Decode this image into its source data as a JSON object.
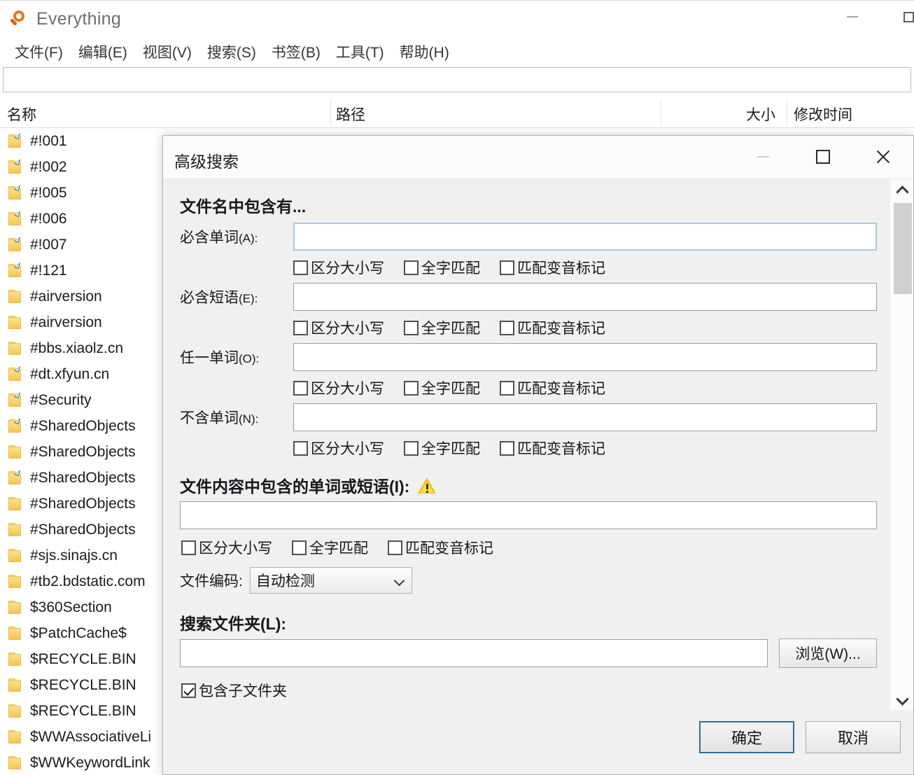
{
  "app": {
    "title": "Everything",
    "logo_icon": "magnifier-icon",
    "window_controls": {
      "minimize": "minimize-icon",
      "maximize": "maximize-icon"
    }
  },
  "menubar": {
    "items": [
      {
        "label": "文件(F)"
      },
      {
        "label": "编辑(E)"
      },
      {
        "label": "视图(V)"
      },
      {
        "label": "搜索(S)"
      },
      {
        "label": "书签(B)"
      },
      {
        "label": "工具(T)"
      },
      {
        "label": "帮助(H)"
      }
    ]
  },
  "search": {
    "value": "",
    "placeholder": ""
  },
  "columns": {
    "name": "名称",
    "path": "路径",
    "size": "大小",
    "date_modified": "修改时间"
  },
  "file_list": {
    "rows": [
      {
        "name": "#!001",
        "icon": "folder-shortcut-icon",
        "shortcut": true
      },
      {
        "name": "#!002",
        "icon": "folder-shortcut-icon",
        "shortcut": true
      },
      {
        "name": "#!005",
        "icon": "folder-shortcut-icon",
        "shortcut": true
      },
      {
        "name": "#!006",
        "icon": "folder-shortcut-icon",
        "shortcut": true
      },
      {
        "name": "#!007",
        "icon": "folder-shortcut-icon",
        "shortcut": true
      },
      {
        "name": "#!121",
        "icon": "folder-shortcut-icon",
        "shortcut": true
      },
      {
        "name": "#airversion",
        "icon": "folder-icon",
        "shortcut": false
      },
      {
        "name": "#airversion",
        "icon": "folder-icon",
        "shortcut": false
      },
      {
        "name": "#bbs.xiaolz.cn",
        "icon": "folder-icon",
        "shortcut": false
      },
      {
        "name": "#dt.xfyun.cn",
        "icon": "folder-shortcut-icon",
        "shortcut": true
      },
      {
        "name": "#Security",
        "icon": "folder-shortcut-icon",
        "shortcut": true
      },
      {
        "name": "#SharedObjects",
        "icon": "folder-shortcut-icon",
        "shortcut": true
      },
      {
        "name": "#SharedObjects",
        "icon": "folder-icon",
        "shortcut": false
      },
      {
        "name": "#SharedObjects",
        "icon": "folder-shortcut-icon",
        "shortcut": true
      },
      {
        "name": "#SharedObjects",
        "icon": "folder-icon",
        "shortcut": false
      },
      {
        "name": "#SharedObjects",
        "icon": "folder-icon",
        "shortcut": false
      },
      {
        "name": "#sjs.sinajs.cn",
        "icon": "folder-icon",
        "shortcut": false
      },
      {
        "name": "#tb2.bdstatic.com",
        "icon": "folder-icon",
        "shortcut": false
      },
      {
        "name": "$360Section",
        "icon": "folder-icon",
        "shortcut": false
      },
      {
        "name": "$PatchCache$",
        "icon": "folder-icon",
        "shortcut": false
      },
      {
        "name": "$RECYCLE.BIN",
        "icon": "folder-icon",
        "shortcut": false
      },
      {
        "name": "$RECYCLE.BIN",
        "icon": "folder-icon",
        "shortcut": false
      },
      {
        "name": "$RECYCLE.BIN",
        "icon": "folder-icon",
        "shortcut": false
      },
      {
        "name": "$WWAssociativeLi",
        "icon": "folder-icon",
        "shortcut": false
      },
      {
        "name": "$WWKeywordLink",
        "icon": "folder-icon",
        "shortcut": false
      }
    ]
  },
  "dialog": {
    "title": "高级搜索",
    "controls": {
      "minimize": "minimize-icon",
      "maximize": "maximize-icon",
      "close": "close-icon"
    },
    "filename_section": {
      "title": "文件名中包含有...",
      "fields": [
        {
          "label": "必含单词",
          "accel": "(A):",
          "value": "",
          "focused": true
        },
        {
          "label": "必含短语",
          "accel": "(E):",
          "value": "",
          "focused": false
        },
        {
          "label": "任一单词",
          "accel": "(O):",
          "value": "",
          "focused": false
        },
        {
          "label": "不含单词",
          "accel": "(N):",
          "value": "",
          "focused": false
        }
      ],
      "checkbox_labels": {
        "match_case": "区分大小写",
        "whole_word": "全字匹配",
        "match_diacritics": "匹配变音标记"
      },
      "checkbox_states": [
        {
          "match_case": false,
          "whole_word": false,
          "match_diacritics": false
        },
        {
          "match_case": false,
          "whole_word": false,
          "match_diacritics": false
        },
        {
          "match_case": false,
          "whole_word": false,
          "match_diacritics": false
        },
        {
          "match_case": false,
          "whole_word": false,
          "match_diacritics": false
        }
      ]
    },
    "content_section": {
      "title": "文件内容中包含的单词或短语(I):",
      "warning_icon": "warning-triangle-icon",
      "value": "",
      "checkboxes": {
        "match_case": "区分大小写",
        "whole_word": "全字匹配",
        "match_diacritics": "匹配变音标记"
      },
      "encoding_label": "文件编码:",
      "encoding_value": "自动检测"
    },
    "folder_section": {
      "title": "搜索文件夹(L):",
      "value": "",
      "browse_label": "浏览(W)...",
      "include_subfolders_label": "包含子文件夹",
      "include_subfolders_checked": true
    },
    "footer": {
      "ok_label": "确定",
      "cancel_label": "取消"
    }
  },
  "colors": {
    "dialog_bg": "#f0f0f0",
    "accent_focus": "#2f6f94",
    "folder_yellow": "#fdd26a",
    "logo_orange": "#e07a1a",
    "warning_yellow": "#f2c019"
  }
}
